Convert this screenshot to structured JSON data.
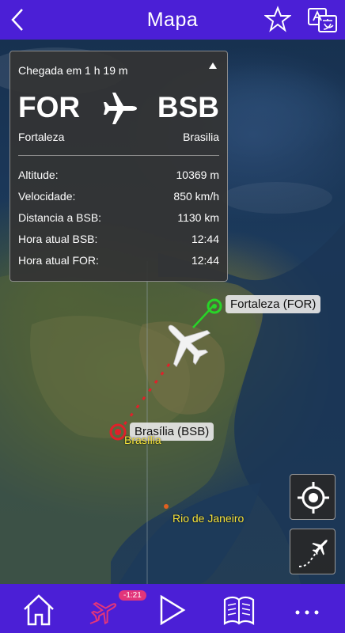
{
  "header": {
    "title": "Mapa"
  },
  "flight": {
    "arrival_text": "Chegada em 1 h 19 m",
    "from_code": "FOR",
    "to_code": "BSB",
    "from_city": "Fortaleza",
    "to_city": "Brasilia",
    "details": [
      {
        "label": "Altitude:",
        "value": "10369 m"
      },
      {
        "label": "Velocidade:",
        "value": "850 km/h"
      },
      {
        "label": "Distancia a BSB:",
        "value": "1130 km"
      },
      {
        "label": "Hora atual BSB:",
        "value": "12:44"
      },
      {
        "label": "Hora atual FOR:",
        "value": "12:44"
      }
    ]
  },
  "map": {
    "origin_label": "Fortaleza (FOR)",
    "destination_label": "Brasília (BSB)",
    "destination_city": "Brasília",
    "rio_city": "Rio de Janeiro"
  },
  "bottom_nav": {
    "badge": "-1:21"
  },
  "colors": {
    "accent": "#4b1fd6",
    "badge": "#e2357a",
    "origin": "#28d428",
    "destination": "#e0202a",
    "city_label": "#f5e23a"
  },
  "icons": [
    "back-icon",
    "star-icon",
    "translate-icon",
    "airplane-icon",
    "locate-icon",
    "flight-path-icon",
    "home-icon",
    "flight-icon",
    "play-icon",
    "book-icon",
    "more-icon"
  ]
}
